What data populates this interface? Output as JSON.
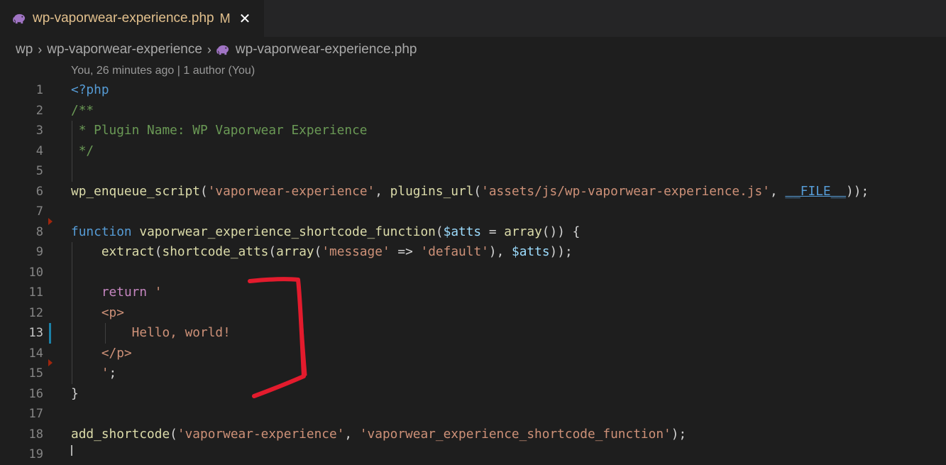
{
  "tab": {
    "title": "wp-vaporwear-experience.php",
    "modified": "M",
    "close": "✕",
    "icon": "php-elephant-icon"
  },
  "breadcrumb": {
    "items": [
      "wp",
      "wp-vaporwear-experience",
      "wp-vaporwear-experience.php"
    ],
    "separator": "›"
  },
  "codelens": "You, 26 minutes ago | 1 author (You)",
  "editor": {
    "line_numbers": [
      "1",
      "2",
      "3",
      "4",
      "5",
      "6",
      "7",
      "8",
      "9",
      "10",
      "11",
      "12",
      "13",
      "14",
      "15",
      "16",
      "17",
      "18",
      "19"
    ],
    "tokens": {
      "l1_open": "<?php",
      "l2_cmt": "/**",
      "l3_cmt": " * Plugin Name: WP Vaporwear Experience",
      "l4_cmt": " */",
      "l6_fn": "wp_enqueue_script",
      "l6_p1": "(",
      "l6_s1": "'vaporwear-experience'",
      "l6_c1": ", ",
      "l6_fn2": "plugins_url",
      "l6_p2": "(",
      "l6_s2": "'assets/js/wp-vaporwear-experience.js'",
      "l6_c2": ", ",
      "l6_magic": "__FILE__",
      "l6_end": "));",
      "l8_kw": "function",
      "l8_sp": " ",
      "l8_fn": "vaporwear_experience_shortcode_function",
      "l8_p": "(",
      "l8_var": "$atts",
      "l8_eq": " = ",
      "l8_arr": "array",
      "l8_end": "()) {",
      "l9_fn": "extract",
      "l9_p1": "(",
      "l9_fn2": "shortcode_atts",
      "l9_p2": "(",
      "l9_arr": "array",
      "l9_p3": "(",
      "l9_s1": "'message'",
      "l9_arrow": " => ",
      "l9_s2": "'default'",
      "l9_c": "), ",
      "l9_var": "$atts",
      "l9_end": "));",
      "l11_ret": "return",
      "l11_str": " '",
      "l12_str": "<p>",
      "l13_str": "Hello, world!",
      "l14_str": "</p>",
      "l15_str": "'",
      "l15_end": ";",
      "l16_brace": "}",
      "l18_fn": "add_shortcode",
      "l18_p": "(",
      "l18_s1": "'vaporwear-experience'",
      "l18_c": ", ",
      "l18_s2": "'vaporwear_experience_shortcode_function'",
      "l18_end": ");"
    }
  },
  "colors": {
    "editor_bg": "#1e1e1e",
    "tab_modified": "#e2c08d",
    "keyword": "#569cd6",
    "function": "#dcdcaa",
    "string": "#ce9178",
    "comment": "#6a9955",
    "variable": "#9cdcfe",
    "control": "#c586c0",
    "annotation": "#e31b2d"
  }
}
